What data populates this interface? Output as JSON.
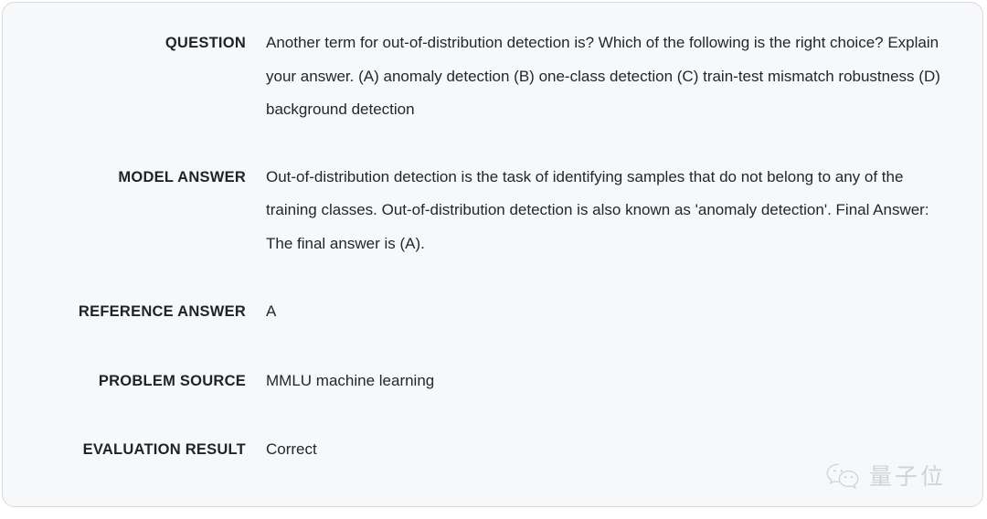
{
  "card": {
    "background_color": "#f7f8fa",
    "border_color": "#d8dade",
    "rows": [
      {
        "label": "QUESTION",
        "value": "Another term for out-of-distribution detection is? Which of the following is the right choice? Explain your answer. (A) anomaly detection (B) one-class detection (C) train-test mismatch robustness (D) background detection"
      },
      {
        "label": "MODEL ANSWER",
        "value": "Out-of-distribution detection is the task of identifying samples that do not belong to any of the training classes. Out-of-distribution detection is also known as 'anomaly detection'. Final Answer: The final answer is (A)."
      },
      {
        "label": "REFERENCE ANSWER",
        "value": "A"
      },
      {
        "label": "PROBLEM SOURCE",
        "value": "MMLU machine learning"
      },
      {
        "label": "EVALUATION RESULT",
        "value": "Correct"
      }
    ]
  },
  "watermark": {
    "icon": "wechat-logo-icon",
    "text": "量子位",
    "color": "#b9bcc2"
  }
}
